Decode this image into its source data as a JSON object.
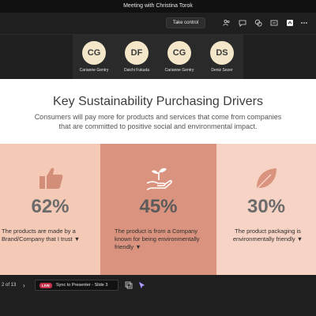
{
  "window": {
    "title": "Meeting with Christina Torok"
  },
  "toolbar": {
    "take_control_label": "Take control",
    "icons": [
      "people-icon",
      "chat-icon",
      "reactions-icon",
      "breakout-icon",
      "more-icon",
      "camera-icon",
      "ellipsis-icon"
    ]
  },
  "participants": [
    {
      "initials": "CG",
      "name": "Carianne Gentry"
    },
    {
      "initials": "DF",
      "name": "Daichi Fukuda"
    },
    {
      "initials": "CG",
      "name": "Carianne Gentry"
    },
    {
      "initials": "DS",
      "name": "Deniz Sezer"
    }
  ],
  "slide": {
    "title": "Key Sustainability Purchasing Drivers",
    "subtitle": "Consumers will pay more for products and services that come from companies that are committed to positive social and environmental impact.",
    "panels": [
      {
        "icon": "thumbs-up-icon",
        "value": "62%",
        "text": "The products are made by a Brand/Company that I trust ▼",
        "color": "#f4c9b6"
      },
      {
        "icon": "hand-plant-icon",
        "value": "45%",
        "text": "The product is from a Company known for being environmentally friendly  ▼",
        "color": "#d9937e"
      },
      {
        "icon": "leaf-icon",
        "value": "30%",
        "text": "The product packaging is environmentally friendly ▼",
        "color": "#f6d3c4"
      }
    ]
  },
  "bottom": {
    "pager": "2 of 13",
    "live_badge": "LIVE",
    "sync_label": "Sync to Presenter - Slide 3"
  },
  "colors": {
    "live": "#c4314b",
    "accent": "#d9937e"
  }
}
